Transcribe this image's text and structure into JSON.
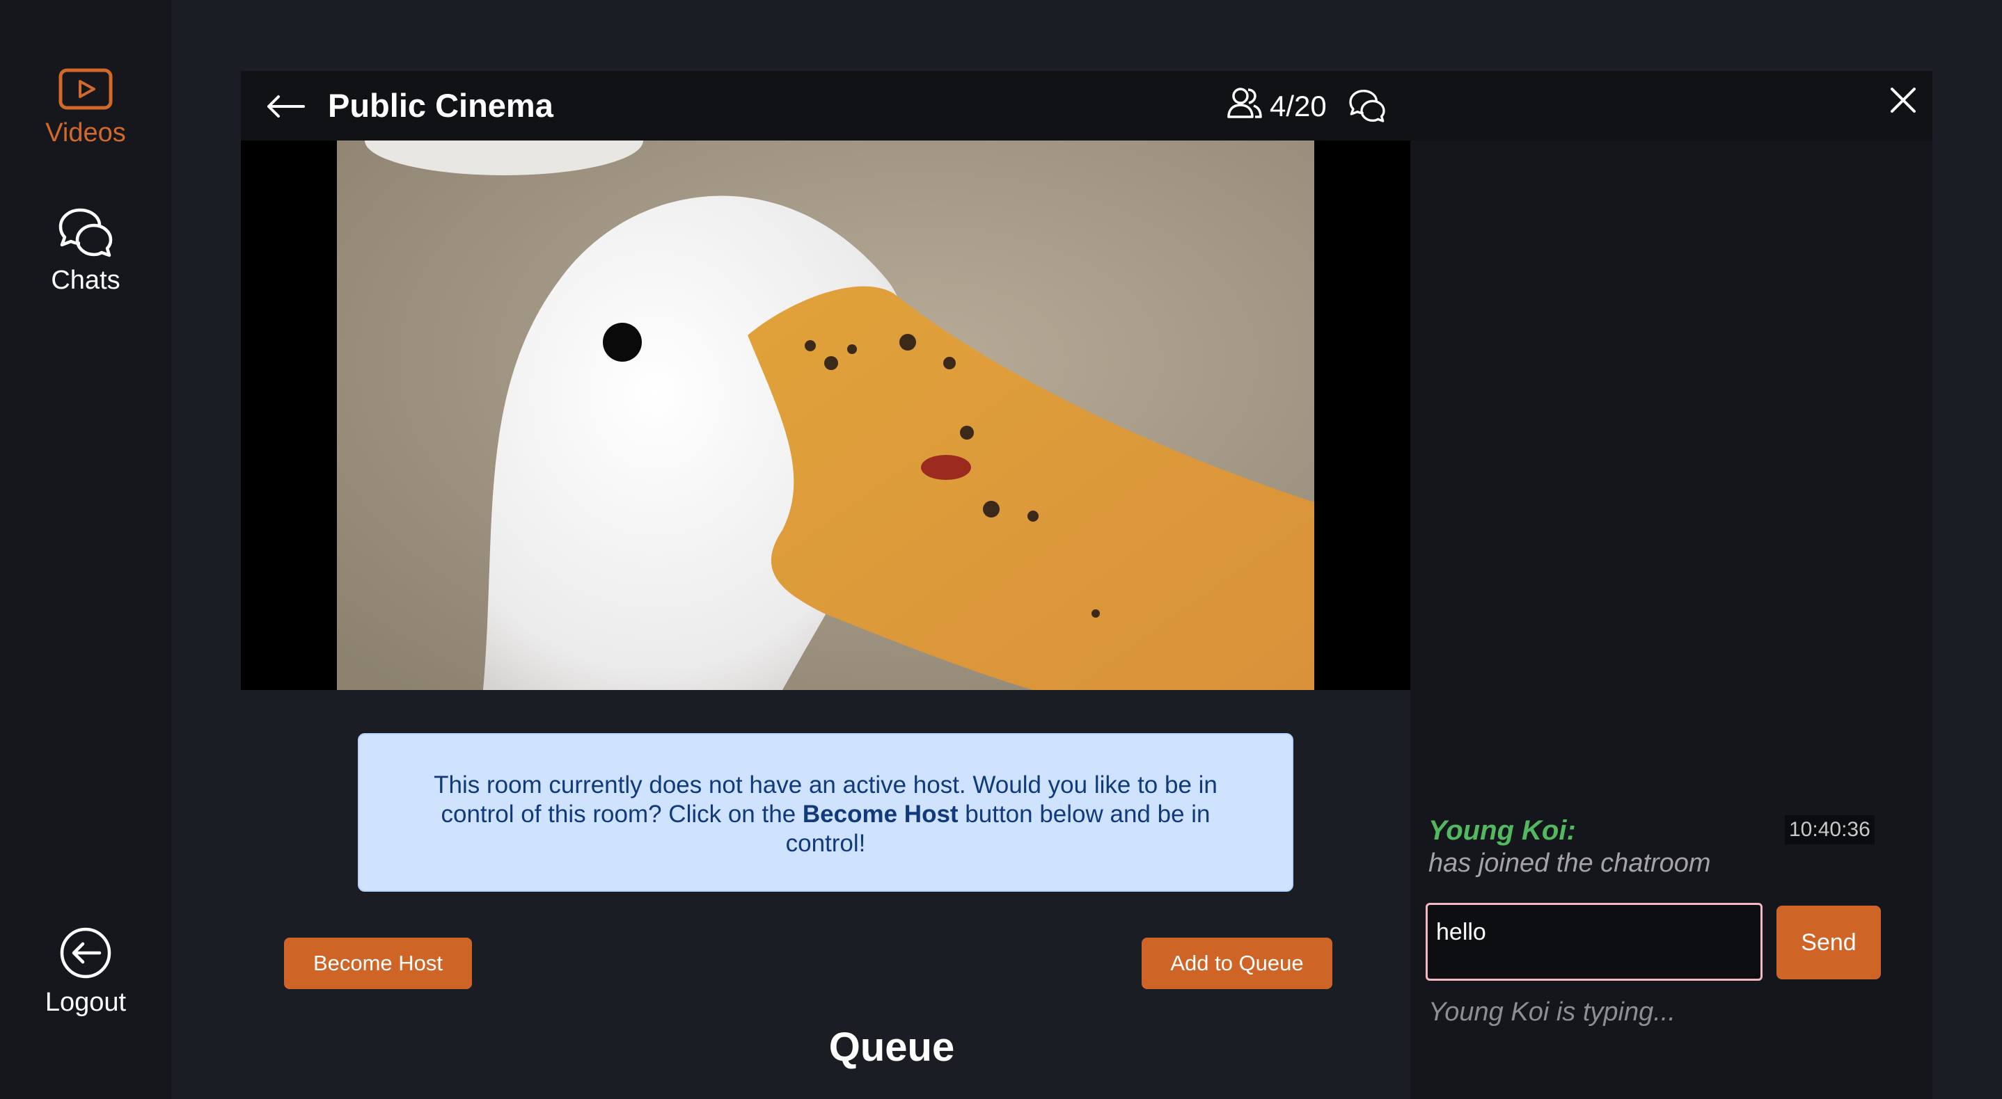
{
  "sidebar": {
    "items": [
      {
        "label": "Videos",
        "icon": "video-play-icon",
        "active": true
      },
      {
        "label": "Chats",
        "icon": "chat-bubbles-icon",
        "active": false
      }
    ],
    "logout_label": "Logout",
    "logout_icon": "logout-icon"
  },
  "room": {
    "title": "Public Cinema",
    "user_count": "4/20"
  },
  "alert": {
    "text_before": "This room currently does not have an active host. Would you like to be in control of this room? Click on the ",
    "bold": "Become Host",
    "text_after": " button below and be in control!"
  },
  "actions": {
    "become_host_label": "Become Host",
    "add_to_queue_label": "Add to Queue"
  },
  "queue": {
    "title": "Queue"
  },
  "chat": {
    "messages": [
      {
        "name": "Young Koi:",
        "text": "has joined the chatroom",
        "time": "10:40:36"
      }
    ],
    "input_value": "hello",
    "send_label": "Send",
    "typing_text": "Young Koi is typing..."
  },
  "colors": {
    "accent": "#d2692b",
    "button": "#cf6427",
    "alert_bg": "#cfe2fe",
    "username": "#52b95f"
  }
}
